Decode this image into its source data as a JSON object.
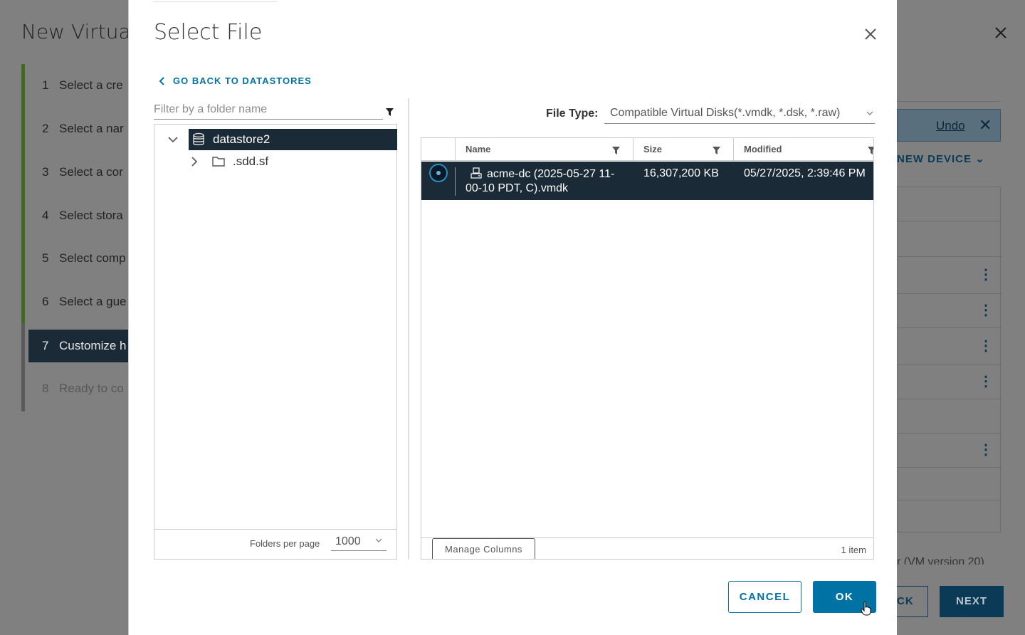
{
  "background": {
    "title": "New Virtual",
    "steps": [
      {
        "num": "1",
        "label": "Select a cre"
      },
      {
        "num": "2",
        "label": "Select a nar"
      },
      {
        "num": "3",
        "label": "Select a cor"
      },
      {
        "num": "4",
        "label": "Select stora"
      },
      {
        "num": "5",
        "label": "Select comp"
      },
      {
        "num": "6",
        "label": "Select a gue"
      },
      {
        "num": "7",
        "label": "Customize h"
      },
      {
        "num": "8",
        "label": "Ready to co"
      }
    ],
    "undo_label": "Undo",
    "new_device_label": "NEW DEVICE",
    "version_text": "r (VM version 20)",
    "back_label": "CK",
    "next_label": "NEXT"
  },
  "modal": {
    "title": "Select File",
    "back_link": "GO BACK TO DATASTORES",
    "filter_placeholder": "Filter by a folder name",
    "tree": {
      "root": "datastore2",
      "children": [
        ".sdd.sf"
      ]
    },
    "folders_per_page_label": "Folders per page",
    "folders_per_page_value": "1000",
    "file_type_label": "File Type:",
    "file_type_value": "Compatible Virtual Disks(*.vmdk, *.dsk, *.raw)",
    "columns": [
      "Name",
      "Size",
      "Modified"
    ],
    "rows": [
      {
        "name": "acme-dc (2025-05-27 11-00-10 PDT, C).vmdk",
        "size": "16,307,200 KB",
        "modified": "05/27/2025, 2:39:46 PM",
        "selected": true
      }
    ],
    "manage_columns_label": "Manage Columns",
    "item_count": "1 item",
    "cancel_label": "CANCEL",
    "ok_label": "OK"
  },
  "colors": {
    "accent": "#0072a3",
    "selected_row": "#1b2a37"
  }
}
